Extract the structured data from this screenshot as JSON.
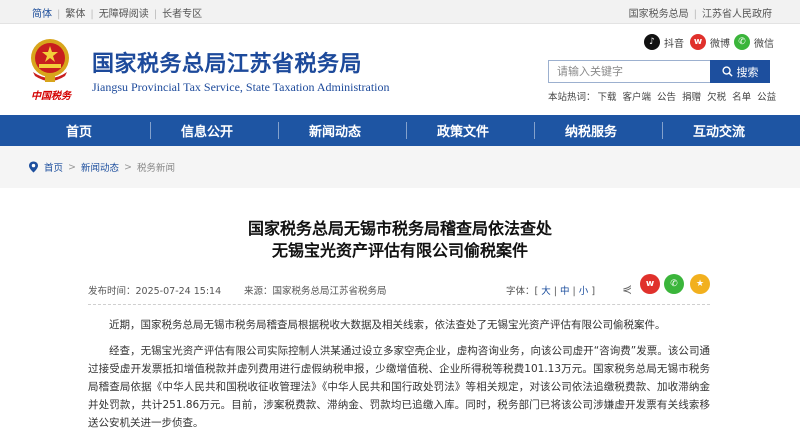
{
  "topbar": {
    "left_links": [
      "简体",
      "繁体",
      "无障碍阅读",
      "长者专区"
    ],
    "right_links": [
      "国家税务总局",
      "江苏省人民政府"
    ]
  },
  "header": {
    "site_title": "国家税务总局江苏省税务局",
    "site_subtitle": "Jiangsu Provincial Tax Service, State Taxation Administration",
    "emblem_caption": "中国税务",
    "social": {
      "douyin": "抖音",
      "weibo": "微博",
      "wechat": "微信"
    },
    "search": {
      "placeholder": "请输入关键字",
      "button_label": "搜索"
    },
    "quick_links": [
      "本站热词：",
      "下载",
      "客户端",
      "公告",
      "捐赠",
      "欠税",
      "名单",
      "公益"
    ]
  },
  "nav": {
    "items": [
      "首页",
      "信息公开",
      "新闻动态",
      "政策文件",
      "纳税服务",
      "互动交流"
    ]
  },
  "breadcrumb": {
    "home": "首页",
    "section": "新闻动态",
    "current": "税务新闻"
  },
  "article": {
    "title_line1": "国家税务总局无锡市税务局稽查局依法查处",
    "title_line2": "无锡宝光资产评估有限公司偷税案件",
    "date": "发布时间：2025-07-24 15:14",
    "source": "来源：国家税务总局江苏省税务局",
    "font_label": "字体：",
    "font_large": "大",
    "font_medium": "中",
    "font_small": "小",
    "paragraphs": [
      "近期，国家税务总局无锡市税务局稽查局根据税收大数据及相关线索，依法查处了无锡宝光资产评估有限公司偷税案件。",
      "经查，无锡宝光资产评估有限公司实际控制人洪某通过设立多家空壳企业，虚构咨询业务，向该公司虚开“咨询费”发票。该公司通过接受虚开发票抵扣增值税款并虚列费用进行虚假纳税申报，少缴增值税、企业所得税等税费101.13万元。国家税务总局无锡市税务局稽查局依据《中华人民共和国税收征收管理法》《中华人民共和国行政处罚法》等相关规定，对该公司依法追缴税费款、加收滞纳金并处罚款，共计251.86万元。目前，涉案税费款、滞纳金、罚款均已追缴入库。同时，税务部门已将该公司涉嫌虚开发票有关线索移送公安机关进一步侦查。"
    ]
  },
  "colors": {
    "brand_blue": "#1d4a9b",
    "nav_blue": "#1e55a3",
    "emblem_red": "#d40000",
    "weibo_red": "#e0312c",
    "wechat_green": "#3bb53b"
  }
}
